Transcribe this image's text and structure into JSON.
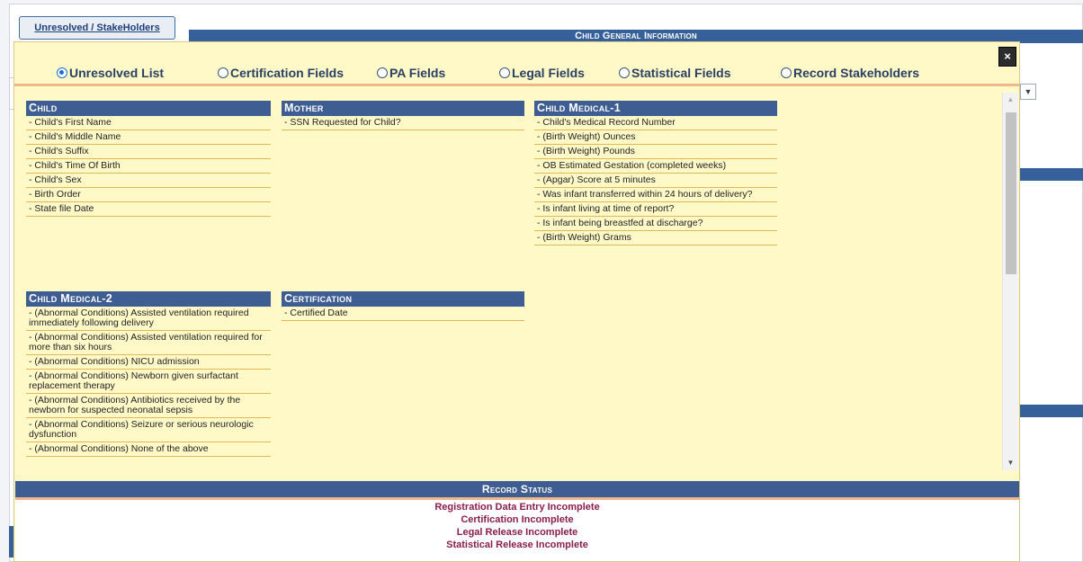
{
  "background": {
    "tab_label": "Unresolved / StakeHolders",
    "header_title": "Child General Information"
  },
  "modal": {
    "close_label": "×",
    "radio_options": [
      {
        "label": "Unresolved List",
        "selected": true
      },
      {
        "label": "Certification Fields",
        "selected": false
      },
      {
        "label": "PA Fields",
        "selected": false
      },
      {
        "label": "Legal Fields",
        "selected": false
      },
      {
        "label": "Statistical Fields",
        "selected": false
      },
      {
        "label": "Record Stakeholders",
        "selected": false
      }
    ],
    "sections": {
      "child": {
        "title": "Child",
        "items": [
          "- Child's First Name",
          "- Child's Middle Name",
          "- Child's Suffix",
          "- Child's Time Of Birth",
          "- Child's Sex",
          "- Birth Order",
          "- State file Date"
        ]
      },
      "mother": {
        "title": "Mother",
        "items": [
          "- SSN Requested for Child?"
        ]
      },
      "child_medical_1": {
        "title": "Child Medical-1",
        "items": [
          "- Child's Medical Record Number",
          "- (Birth Weight) Ounces",
          "- (Birth Weight) Pounds",
          "- OB Estimated Gestation (completed weeks)",
          "- (Apgar) Score at 5 minutes",
          "- Was infant transferred within 24 hours of delivery?",
          "- Is infant living at time of report?",
          "- Is infant being breastfed at discharge?",
          "- (Birth Weight) Grams"
        ]
      },
      "child_medical_2": {
        "title": "Child Medical-2",
        "items": [
          "- (Abnormal Conditions) Assisted ventilation required immediately following delivery",
          "- (Abnormal Conditions) Assisted ventilation required for more than six hours",
          "- (Abnormal Conditions) NICU admission",
          "- (Abnormal Conditions) Newborn given surfactant replacement therapy",
          "- (Abnormal Conditions) Antibiotics received by the newborn for suspected neonatal sepsis",
          "- (Abnormal Conditions) Seizure or serious neurologic dysfunction",
          "- (Abnormal Conditions) None of the above"
        ]
      },
      "certification": {
        "title": "Certification",
        "items": [
          "- Certified Date"
        ]
      }
    },
    "record_status": {
      "title": "Record Status",
      "lines": [
        "Registration Data Entry Incomplete",
        "Certification Incomplete",
        "Legal Release Incomplete",
        "Statistical Release Incomplete"
      ]
    }
  }
}
